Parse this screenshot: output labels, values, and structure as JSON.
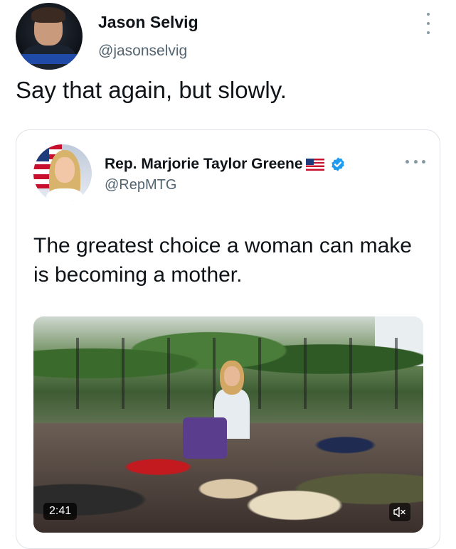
{
  "tweet": {
    "user": {
      "name": "Jason Selvig",
      "handle": "@jasonselvig",
      "avatar_icon": "user-avatar"
    },
    "text": "Say that again, but slowly.",
    "menu_icon": "more-vertical-icon"
  },
  "quoted_tweet": {
    "user": {
      "name": "Rep. Marjorie Taylor Greene",
      "handle": "@RepMTG",
      "flag_icon": "us-flag-icon",
      "verified_icon": "verified-badge-icon"
    },
    "text": "The greatest choice a woman can make is becoming a mother.",
    "menu_icon": "more-horizontal-icon",
    "video": {
      "duration": "2:41",
      "mute_icon": "speaker-muted-icon"
    }
  },
  "colors": {
    "text": "#0f1419",
    "secondary": "#536471",
    "verified": "#1d9bf0",
    "border": "#dfe3e8"
  }
}
